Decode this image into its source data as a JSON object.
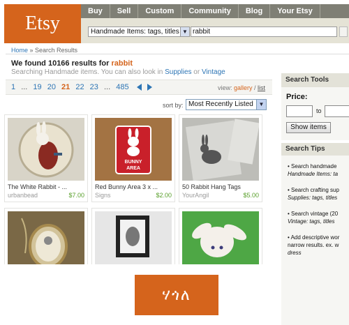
{
  "logo": {
    "text": "Etsy"
  },
  "nav": [
    "Buy",
    "Sell",
    "Custom",
    "Community",
    "Blog",
    "Your Etsy"
  ],
  "search": {
    "category": "Handmade Items: tags, titles",
    "query": "rabbit"
  },
  "breadcrumb": {
    "home": "Home",
    "sep": " » ",
    "current": "Search Results"
  },
  "results": {
    "found_prefix": "We found 10166 results for ",
    "query": "rabbit",
    "also_prefix": "Searching Handmade items. You can also look in ",
    "supplies": "Supplies",
    "or": " or ",
    "vintage": "Vintage"
  },
  "pager": {
    "pages": [
      "1",
      "...",
      "19",
      "20",
      "21",
      "22",
      "23",
      "...",
      "485"
    ],
    "current": "21",
    "view_label": "view: ",
    "gallery": "gallery",
    "slash": " / ",
    "list": "list"
  },
  "sort": {
    "label": "sort by:",
    "value": "Most Recently Listed"
  },
  "listings": [
    {
      "title": "The White Rabbit - ...",
      "shop": "urbanbead",
      "price": "$7.00"
    },
    {
      "title": "Red Bunny Area 3 x ...",
      "shop": "Signs",
      "price": "$2.00"
    },
    {
      "title": "50 Rabbit Hang Tags",
      "shop": "YourAngil",
      "price": "$5.00"
    }
  ],
  "bunny_sign": {
    "line1": "BUNNY",
    "line2": "AREA"
  },
  "search_tools": {
    "title": "Search Tools",
    "price_label": "Price:",
    "to": "to",
    "button": "Show items"
  },
  "search_tips": {
    "title": "Search Tips",
    "tip1a": "• Search handmade",
    "tip1b": "Handmade Items: ta",
    "tip2a": "• Search crafting sup",
    "tip2b": "Supplies: tags, titles",
    "tip3a": "• Search vintage (20",
    "tip3b": "Vintage: tags, titles",
    "tip4a": "• Add descriptive wor",
    "tip4b": "narrow results. ex. w",
    "tip4c": "dress"
  },
  "footer_logo": {
    "text": "ሃጎለ"
  },
  "colors": {
    "brand": "#d5641c",
    "link": "#2d75b5",
    "nav_bg": "#7f7f75",
    "price": "#5aa02c"
  }
}
